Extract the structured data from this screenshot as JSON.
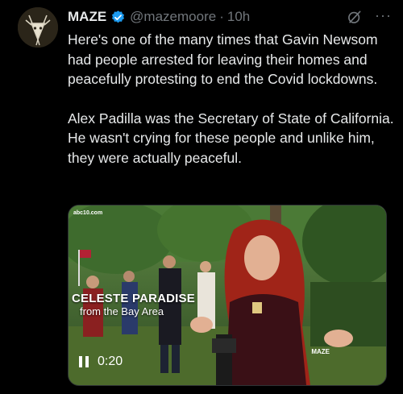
{
  "tweet": {
    "author_name": "MAZE",
    "handle": "@mazemoore",
    "separator": "·",
    "time": "10h",
    "paragraphs": [
      "Here's one of the many times that Gavin Newsom had people arrested for leaving their homes and peacefully protesting to end the Covid lockdowns.",
      "Alex Padilla was the Secretary of State of California. He wasn't crying for these people and unlike him, they were actually peaceful."
    ],
    "more_label": "···",
    "icons": {
      "verified": "verified-badge-icon",
      "grok": "grok-icon",
      "more": "more-icon"
    }
  },
  "video": {
    "source_tag": "abc10.com",
    "lower_third_name": "CELESTE PARADISE",
    "lower_third_sub": "from the Bay Area",
    "watermark": "MAZE",
    "time": "0:20",
    "state": "playing"
  },
  "colors": {
    "background": "#000000",
    "text": "#e7e9ea",
    "secondary": "#71767b",
    "verified": "#1d9bf0"
  }
}
